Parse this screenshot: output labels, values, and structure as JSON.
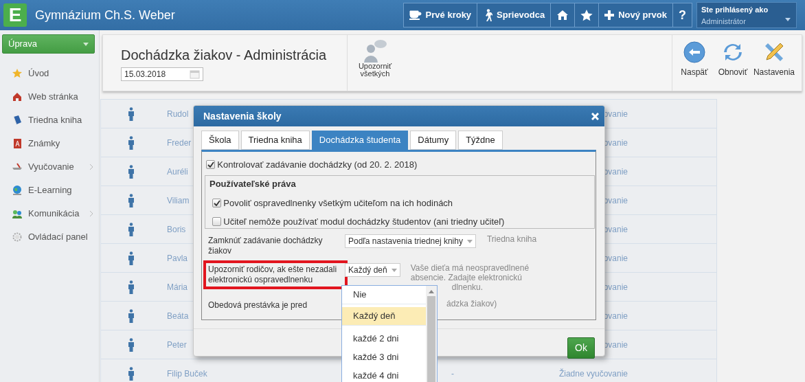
{
  "header": {
    "logo_letter": "E",
    "title": "Gymnázium Ch.S. Weber",
    "buttons": [
      {
        "kind": "cup",
        "label": "Prvé kroky"
      },
      {
        "kind": "walker",
        "label": "Sprievodca"
      },
      {
        "kind": "home"
      },
      {
        "kind": "star"
      },
      {
        "kind": "plus",
        "label": "Nový prvok"
      },
      {
        "kind": "text",
        "label": "?"
      }
    ],
    "user": {
      "caption": "Ste prihlásený ako",
      "name": "Administrátor"
    }
  },
  "sidebar": {
    "dropdown": "Úprava",
    "items": [
      {
        "kind": "star",
        "label": "Úvod",
        "has_submenu": false
      },
      {
        "kind": "web",
        "label": "Web stránka",
        "has_submenu": false
      },
      {
        "kind": "book",
        "label": "Triedna kniha",
        "has_submenu": false
      },
      {
        "kind": "grade",
        "label": "Známky",
        "has_submenu": false
      },
      {
        "kind": "teach",
        "label": "Vyučovanie",
        "has_submenu": true
      },
      {
        "kind": "globe",
        "label": "E-Learning",
        "has_submenu": false
      },
      {
        "kind": "people",
        "label": "Komunikácia",
        "has_submenu": true
      },
      {
        "kind": "gear",
        "label": "Ovládací panel",
        "has_submenu": false
      }
    ]
  },
  "toolbar": {
    "title": "Dochádzka žiakov - Administrácia",
    "date": "15.03.2018",
    "notify": "Upozorniť všetkých",
    "actions": [
      {
        "kind": "back",
        "label": "Naspäť"
      },
      {
        "kind": "refresh",
        "label": "Obnoviť"
      },
      {
        "kind": "tools",
        "label": "Nastavenia"
      }
    ]
  },
  "table": {
    "rows": [
      {
        "column_1": "Rudol",
        "column_3": "ovanie"
      },
      {
        "column_1": "Freder",
        "column_3": "ovanie"
      },
      {
        "column_1": "Auréli",
        "column_3": "ovanie"
      },
      {
        "column_1": "Viliam",
        "column_3": "ovanie"
      },
      {
        "column_1": "Boris",
        "column_3": "ovanie"
      },
      {
        "column_1": "Pavla",
        "column_3": "ovanie"
      },
      {
        "column_1": "Mária",
        "column_3": "ovanie"
      },
      {
        "column_1": "Beáta",
        "column_3": "ovanie"
      },
      {
        "column_1": "Peter",
        "column_3": "ovanie"
      },
      {
        "column_1": "Filip Buček",
        "column_2": "-",
        "column_3": "Žiadne vyučovanie"
      }
    ]
  },
  "dialog": {
    "title": "Nastavenia školy",
    "tabs": [
      {
        "label": "Škola",
        "selected": false
      },
      {
        "label": "Triedna kniha",
        "selected": false
      },
      {
        "label": "Dochádzka študenta",
        "selected": true
      },
      {
        "label": "Dátumy",
        "selected": false
      },
      {
        "label": "Týždne",
        "selected": false
      }
    ],
    "check": {
      "label": "Kontrolovať zadávanie dochádzky (od 20. 2. 2018)",
      "checked": true
    },
    "group": {
      "title": "Používateľské práva",
      "items": [
        {
          "label": "Povoliť ospravedlnenky všetkým učiteľom na ich hodinách",
          "checked": true
        },
        {
          "label": "Učiteľ nemôže používať modul dochádzky študentov (ani triedny učiteľ)",
          "checked": false
        }
      ]
    },
    "settings": [
      {
        "label": "Zamknúť zadávanie dochádzky žiakov",
        "value": "Podľa nastavenia triednej knihy",
        "note": [
          "Triedna kniha"
        ],
        "highlighted": false
      },
      {
        "label": "Upozorniť rodičov, ak ešte nezadali elektronickú ospravedlnenku",
        "value": "Každý deň",
        "note": [
          "Vaše dieťa má neospravedlnené",
          "absencie. Zadajte elektronickú",
          "dlnenku."
        ],
        "highlighted": true
      },
      {
        "label": "Obedová prestávka je pred",
        "note": [
          "ádzka žiakov)"
        ],
        "highlighted": false
      }
    ],
    "options": [
      {
        "label": "Nie",
        "selected": false
      },
      {
        "label": "Každý deň",
        "selected": true
      },
      {
        "label": "každé 2 dni",
        "selected": false
      },
      {
        "label": "každé 3 dni",
        "selected": false
      },
      {
        "label": "každé 4 dni",
        "selected": false
      }
    ],
    "ok": "Ok"
  }
}
